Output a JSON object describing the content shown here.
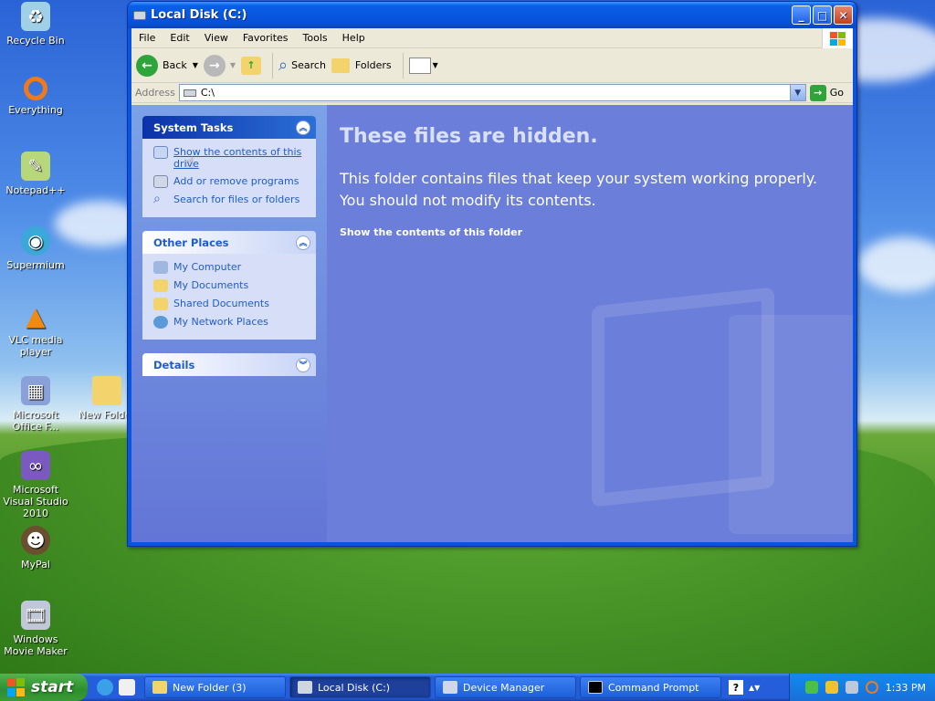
{
  "desktop": {
    "icons": [
      {
        "label": "Recycle Bin",
        "name": "recycle-bin-icon",
        "color": "#9fd0e8"
      },
      {
        "label": "Everything",
        "name": "everything-icon",
        "color": "#f07a1a"
      },
      {
        "label": "Notepad++",
        "name": "notepad-plus-plus-icon",
        "color": "#b8d67a"
      },
      {
        "label": "Supermium",
        "name": "supermium-icon",
        "color": "#3aa8d8"
      },
      {
        "label": "VLC media player",
        "name": "vlc-icon",
        "color": "#f08a10"
      },
      {
        "label": "Microsoft Office F...",
        "name": "office-icon",
        "color": "#8aa0d8"
      },
      {
        "label": "Microsoft Visual Studio 2010",
        "name": "visual-studio-icon",
        "color": "#7a5ac0"
      },
      {
        "label": "MyPal",
        "name": "mypal-icon",
        "color": "#6a5030"
      },
      {
        "label": "Windows Movie Maker",
        "name": "movie-maker-icon",
        "color": "#c0c8d8"
      }
    ],
    "new_folder_label": "New Folder"
  },
  "window": {
    "title": "Local Disk (C:)",
    "minimize": "_",
    "maximize": "□",
    "close": "✕",
    "menu": [
      "File",
      "Edit",
      "View",
      "Favorites",
      "Tools",
      "Help"
    ],
    "toolbar": {
      "back": "Back",
      "search": "Search",
      "folders": "Folders"
    },
    "address": {
      "label": "Address",
      "value": "C:\\",
      "go": "Go"
    }
  },
  "left_pane": {
    "system_tasks": {
      "title": "System Tasks",
      "items": [
        "Show the contents of this drive",
        "Add or remove programs",
        "Search for files or folders"
      ]
    },
    "other_places": {
      "title": "Other Places",
      "items": [
        "My Computer",
        "My Documents",
        "Shared Documents",
        "My Network Places"
      ]
    },
    "details": {
      "title": "Details"
    }
  },
  "main_pane": {
    "heading": "These files are hidden.",
    "body": "This folder contains files that keep your system working properly. You should not modify its contents.",
    "link": "Show the contents of this folder"
  },
  "taskbar": {
    "start": "start",
    "tasks": [
      {
        "label": "New Folder (3)",
        "active": false
      },
      {
        "label": "Local Disk (C:)",
        "active": true
      },
      {
        "label": "Device Manager",
        "active": false
      },
      {
        "label": "Command Prompt",
        "active": false
      }
    ],
    "clock": "1:33 PM"
  },
  "colors": {
    "title_blue": "#0a55e0",
    "panel_link": "#215dc6",
    "main_pane_bg": "#6b7ed9"
  }
}
